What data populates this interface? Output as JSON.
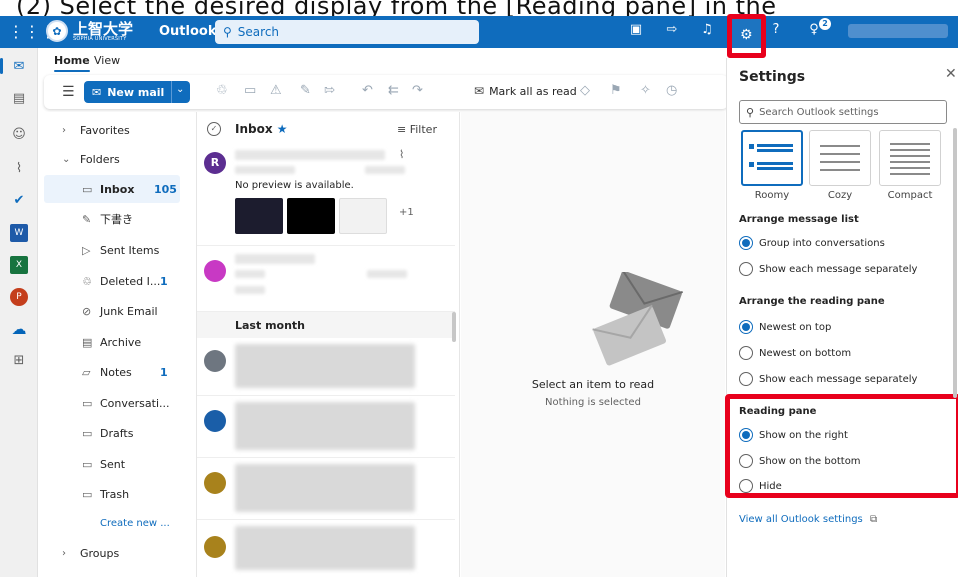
{
  "caption": "(2) Select the desired display from the [Reading pane] in the",
  "topbar": {
    "university_jp": "上智大学",
    "university_en": "SOPHIA UNIVERSITY",
    "app": "Outlook",
    "search_placeholder": "Search",
    "notification_count": "2",
    "accent": "#0f6cbd"
  },
  "ribbon": {
    "tabs": [
      "Home",
      "View"
    ],
    "new_mail": "New mail",
    "mark_all_read": "Mark all as read"
  },
  "folders": {
    "favorites": "Favorites",
    "folders": "Folders",
    "items": [
      {
        "icon": "inbox-icon",
        "name": "Inbox",
        "count": "105"
      },
      {
        "icon": "drafts-icon",
        "name": "下書き",
        "count": ""
      },
      {
        "icon": "sent-icon",
        "name": "Sent Items",
        "count": ""
      },
      {
        "icon": "trash-icon",
        "name": "Deleted I...",
        "count": "1"
      },
      {
        "icon": "junk-icon",
        "name": "Junk Email",
        "count": ""
      },
      {
        "icon": "archive-icon",
        "name": "Archive",
        "count": ""
      },
      {
        "icon": "notes-icon",
        "name": "Notes",
        "count": "1"
      },
      {
        "icon": "folder-icon",
        "name": "Conversati...",
        "count": ""
      },
      {
        "icon": "folder-icon",
        "name": "Drafts",
        "count": ""
      },
      {
        "icon": "folder-icon",
        "name": "Sent",
        "count": ""
      },
      {
        "icon": "folder-icon",
        "name": "Trash",
        "count": ""
      }
    ],
    "create_new": "Create new ...",
    "groups": "Groups"
  },
  "message_list": {
    "title": "Inbox",
    "filter": "Filter",
    "first_preview": "No preview is available.",
    "more_attachments": "+1",
    "section": "Last month",
    "avatar_initial": "R"
  },
  "reading_pane": {
    "empty_title": "Select an item to read",
    "empty_sub": "Nothing is selected"
  },
  "settings": {
    "title": "Settings",
    "search_placeholder": "Search Outlook settings",
    "density": [
      "Roomy",
      "Cozy",
      "Compact"
    ],
    "arrange_list_title": "Arrange message list",
    "arrange_list": [
      {
        "label": "Group into conversations",
        "checked": true
      },
      {
        "label": "Show each message separately",
        "checked": false
      }
    ],
    "arrange_pane_title": "Arrange the reading pane",
    "arrange_pane": [
      {
        "label": "Newest on top",
        "checked": true
      },
      {
        "label": "Newest on bottom",
        "checked": false
      },
      {
        "label": "Show each message separately",
        "checked": false
      }
    ],
    "reading_pane_title": "Reading pane",
    "reading_pane": [
      {
        "label": "Show on the right",
        "checked": true
      },
      {
        "label": "Show on the bottom",
        "checked": false
      },
      {
        "label": "Hide",
        "checked": false
      }
    ],
    "view_all": "View all Outlook settings",
    "highlight_color": "#e8001c"
  }
}
